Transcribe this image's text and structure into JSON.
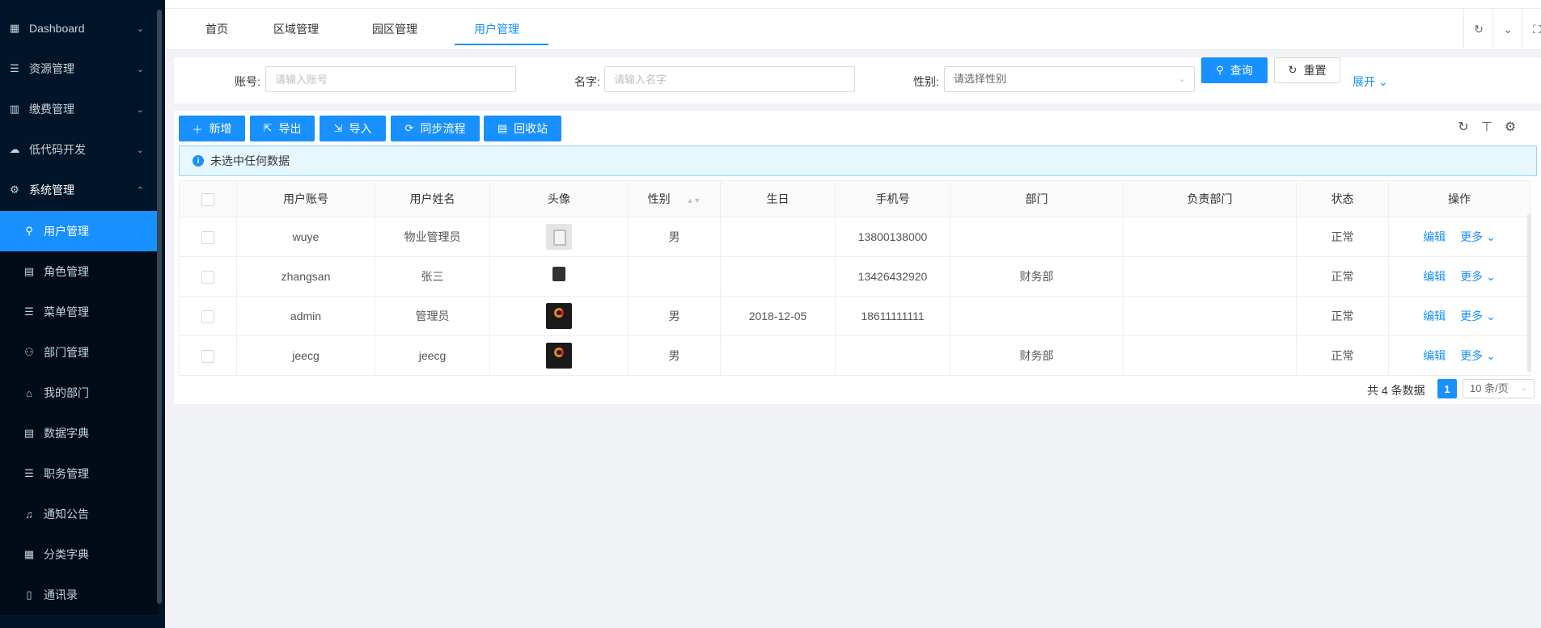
{
  "sidebar": {
    "items": [
      {
        "label": "Dashboard",
        "icon": "dashboard-icon",
        "glyph": "▦",
        "arrow": "⌄"
      },
      {
        "label": "资源管理",
        "icon": "database-icon",
        "glyph": "☰",
        "arrow": "⌄"
      },
      {
        "label": "缴费管理",
        "icon": "table-icon",
        "glyph": "▥",
        "arrow": "⌄"
      },
      {
        "label": "低代码开发",
        "icon": "cloud-icon",
        "glyph": "☁",
        "arrow": "⌄"
      },
      {
        "label": "系统管理",
        "icon": "gear-icon",
        "glyph": "⚙",
        "arrow": "⌃"
      }
    ],
    "subitems": [
      {
        "label": "用户管理",
        "icon": "user-icon",
        "glyph": "⚲"
      },
      {
        "label": "角色管理",
        "icon": "role-icon",
        "glyph": "▤"
      },
      {
        "label": "菜单管理",
        "icon": "menu-icon",
        "glyph": "☰"
      },
      {
        "label": "部门管理",
        "icon": "team-icon",
        "glyph": "⚇"
      },
      {
        "label": "我的部门",
        "icon": "home-icon",
        "glyph": "⌂"
      },
      {
        "label": "数据字典",
        "icon": "book-icon",
        "glyph": "▤"
      },
      {
        "label": "职务管理",
        "icon": "database-icon",
        "glyph": "☰"
      },
      {
        "label": "通知公告",
        "icon": "bell-icon",
        "glyph": "♫"
      },
      {
        "label": "分类字典",
        "icon": "list-icon",
        "glyph": "▦"
      },
      {
        "label": "通讯录",
        "icon": "contacts-icon",
        "glyph": "▯"
      }
    ]
  },
  "tabs": [
    "首页",
    "区域管理",
    "园区管理",
    "用户管理"
  ],
  "topbar_buttons": {
    "reload": "↻",
    "dropdown": "⌄",
    "fullscreen": "⛶"
  },
  "search": {
    "account_label": "账号:",
    "account_placeholder": "请输入账号",
    "name_label": "名字:",
    "name_placeholder": "请输入名字",
    "gender_label": "性别:",
    "gender_placeholder": "请选择性别",
    "query_button": "查询",
    "reset_button": "重置",
    "expand_link": "展开"
  },
  "toolbar": {
    "add": "新增",
    "export": "导出",
    "import": "导入",
    "sync": "同步流程",
    "recycle": "回收站"
  },
  "alert": "未选中任何数据",
  "table": {
    "columns": [
      "用户账号",
      "用户姓名",
      "头像",
      "性别",
      "生日",
      "手机号",
      "部门",
      "负责部门",
      "状态",
      "操作"
    ],
    "rows": [
      {
        "account": "wuye",
        "name": "物业管理员",
        "avatar": "placeholder",
        "gender": "男",
        "birthday": "",
        "phone": "13800138000",
        "dept": "",
        "charge_dept": "",
        "status": "正常"
      },
      {
        "account": "zhangsan",
        "name": "张三",
        "avatar": "small",
        "gender": "",
        "birthday": "",
        "phone": "13426432920",
        "dept": "财务部",
        "charge_dept": "",
        "status": "正常"
      },
      {
        "account": "admin",
        "name": "管理员",
        "avatar": "logo",
        "gender": "男",
        "birthday": "2018-12-05",
        "phone": "18611111111",
        "dept": "",
        "charge_dept": "",
        "status": "正常"
      },
      {
        "account": "jeecg",
        "name": "jeecg",
        "avatar": "logo",
        "gender": "男",
        "birthday": "",
        "phone": "",
        "dept": "财务部",
        "charge_dept": "",
        "status": "正常"
      }
    ],
    "edit_label": "编辑",
    "more_label": "更多"
  },
  "pager": {
    "total": "共 4 条数据",
    "current": "1",
    "size": "10 条/页"
  },
  "colors": {
    "primary": "#1890ff",
    "sidebar": "#001529"
  }
}
